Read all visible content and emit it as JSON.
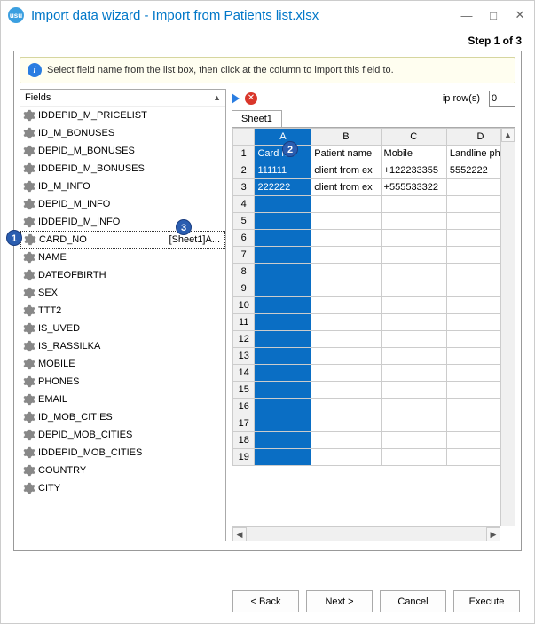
{
  "window": {
    "title": "Import data wizard - Import from Patients list.xlsx",
    "step_label": "Step 1 of 3",
    "info_text": "Select field name from the list box, then click at the column to import this field to."
  },
  "fields": {
    "header": "Fields",
    "items": [
      {
        "label": "IDDEPID_M_PRICELIST",
        "mapping": ""
      },
      {
        "label": "ID_M_BONUSES",
        "mapping": ""
      },
      {
        "label": "DEPID_M_BONUSES",
        "mapping": ""
      },
      {
        "label": "IDDEPID_M_BONUSES",
        "mapping": ""
      },
      {
        "label": "ID_M_INFO",
        "mapping": ""
      },
      {
        "label": "DEPID_M_INFO",
        "mapping": ""
      },
      {
        "label": "IDDEPID_M_INFO",
        "mapping": ""
      },
      {
        "label": "CARD_NO",
        "mapping": "[Sheet1]A...",
        "selected": true
      },
      {
        "label": "NAME",
        "mapping": ""
      },
      {
        "label": "DATEOFBIRTH",
        "mapping": ""
      },
      {
        "label": "SEX",
        "mapping": ""
      },
      {
        "label": "TTT2",
        "mapping": ""
      },
      {
        "label": "IS_UVED",
        "mapping": ""
      },
      {
        "label": "IS_RASSILKA",
        "mapping": ""
      },
      {
        "label": "MOBILE",
        "mapping": ""
      },
      {
        "label": "PHONES",
        "mapping": ""
      },
      {
        "label": "EMAIL",
        "mapping": ""
      },
      {
        "label": "ID_MOB_CITIES",
        "mapping": ""
      },
      {
        "label": "DEPID_MOB_CITIES",
        "mapping": ""
      },
      {
        "label": "IDDEPID_MOB_CITIES",
        "mapping": ""
      },
      {
        "label": "COUNTRY",
        "mapping": ""
      },
      {
        "label": "CITY",
        "mapping": ""
      }
    ]
  },
  "skip": {
    "label": "ip row(s)",
    "value": "0"
  },
  "sheet": {
    "tab": "Sheet1"
  },
  "grid": {
    "columns": [
      "A",
      "B",
      "C",
      "D"
    ],
    "selected_col": "A",
    "rows": [
      {
        "num": "1",
        "cells": [
          "Card no.",
          "Patient name",
          "Mobile",
          "Landline phon"
        ]
      },
      {
        "num": "2",
        "cells": [
          "111111",
          "client from ex",
          "+122233355",
          "5552222"
        ]
      },
      {
        "num": "3",
        "cells": [
          "222222",
          "client from ex",
          "+555533322",
          ""
        ]
      },
      {
        "num": "4",
        "cells": [
          "",
          "",
          "",
          ""
        ]
      },
      {
        "num": "5",
        "cells": [
          "",
          "",
          "",
          ""
        ]
      },
      {
        "num": "6",
        "cells": [
          "",
          "",
          "",
          ""
        ]
      },
      {
        "num": "7",
        "cells": [
          "",
          "",
          "",
          ""
        ]
      },
      {
        "num": "8",
        "cells": [
          "",
          "",
          "",
          ""
        ]
      },
      {
        "num": "9",
        "cells": [
          "",
          "",
          "",
          ""
        ]
      },
      {
        "num": "10",
        "cells": [
          "",
          "",
          "",
          ""
        ]
      },
      {
        "num": "11",
        "cells": [
          "",
          "",
          "",
          ""
        ]
      },
      {
        "num": "12",
        "cells": [
          "",
          "",
          "",
          ""
        ]
      },
      {
        "num": "13",
        "cells": [
          "",
          "",
          "",
          ""
        ]
      },
      {
        "num": "14",
        "cells": [
          "",
          "",
          "",
          ""
        ]
      },
      {
        "num": "15",
        "cells": [
          "",
          "",
          "",
          ""
        ]
      },
      {
        "num": "16",
        "cells": [
          "",
          "",
          "",
          ""
        ]
      },
      {
        "num": "17",
        "cells": [
          "",
          "",
          "",
          ""
        ]
      },
      {
        "num": "18",
        "cells": [
          "",
          "",
          "",
          ""
        ]
      },
      {
        "num": "19",
        "cells": [
          "",
          "",
          "",
          ""
        ]
      }
    ]
  },
  "buttons": {
    "back": "< Back",
    "next": "Next >",
    "cancel": "Cancel",
    "execute": "Execute"
  },
  "badges": {
    "b1": "1",
    "b2": "2",
    "b3": "3"
  }
}
